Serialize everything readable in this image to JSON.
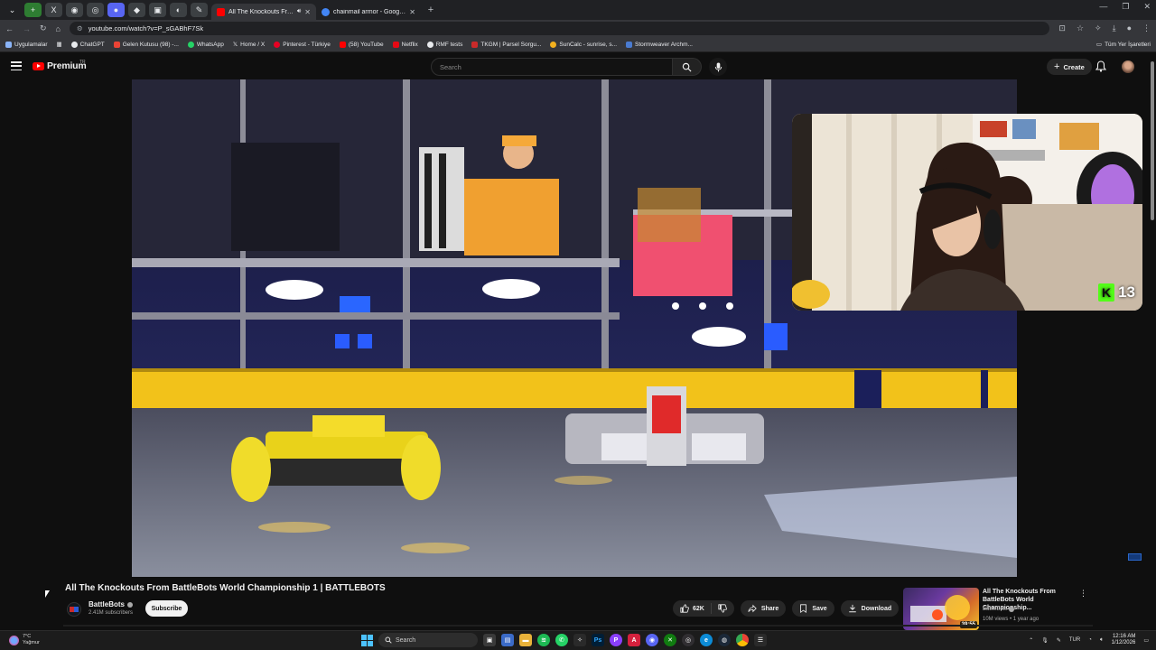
{
  "browser": {
    "pinned_tabs": [
      "",
      "X",
      "",
      "",
      "",
      "",
      "",
      "",
      "",
      ""
    ],
    "tabs": [
      {
        "title": "All The Knockouts From Ba",
        "favicon_color": "#ff0000",
        "active": true
      },
      {
        "title": "chainmail armor - Google'da A",
        "favicon_color": "#4285f4",
        "active": false
      }
    ],
    "url": "youtube.com/watch?v=P_sGABhF7Sk",
    "bookmarks": [
      {
        "label": "Uygulamalar",
        "color": "#8ab4f8"
      },
      {
        "label": "ChatGPT",
        "color": "#e8eaed"
      },
      {
        "label": "Gelen Kutusu (98) -...",
        "color": "#ea4335"
      },
      {
        "label": "WhatsApp",
        "color": "#25d366"
      },
      {
        "label": "Home / X",
        "color": "#e8eaed"
      },
      {
        "label": "Pinterest - Türkiye",
        "color": "#e60023"
      },
      {
        "label": "(58) YouTube",
        "color": "#ff0000"
      },
      {
        "label": "Netflix",
        "color": "#e50914"
      },
      {
        "label": "RMF tests",
        "color": "#e8eaed"
      },
      {
        "label": "TKGM | Parsel Sorgu...",
        "color": "#c92a2a"
      },
      {
        "label": "SunCalc - sunrise, s...",
        "color": "#f2b01e"
      },
      {
        "label": "Stormweaver Archm...",
        "color": "#4a7bd0"
      }
    ],
    "bookmarks_right": "Tüm Yer İşaretleri"
  },
  "youtube": {
    "logo_text": "Premium",
    "region": "TR",
    "search_placeholder": "Search",
    "create_label": "Create"
  },
  "overlay": {
    "streak_count": "13",
    "kick_letter": "K"
  },
  "video": {
    "title": "All The Knockouts From BattleBots World Championship 1 | BATTLEBOTS",
    "channel": "BattleBots",
    "subscribers": "2.41M subscribers",
    "subscribe_label": "Subscribe",
    "likes": "62K",
    "share_label": "Share",
    "save_label": "Save",
    "download_label": "Download",
    "more_label": "•••"
  },
  "recommended": {
    "title": "All The Knockouts From BattleBots World Championship...",
    "channel": "BattleBots",
    "meta": "10M views • 1 year ago",
    "duration": "39:55"
  },
  "taskbar": {
    "weather_temp": "7°C",
    "weather_desc": "Yağmur",
    "search_label": "Search",
    "lang": "TUR",
    "time": "12:16 AM",
    "date": "1/12/2026"
  }
}
